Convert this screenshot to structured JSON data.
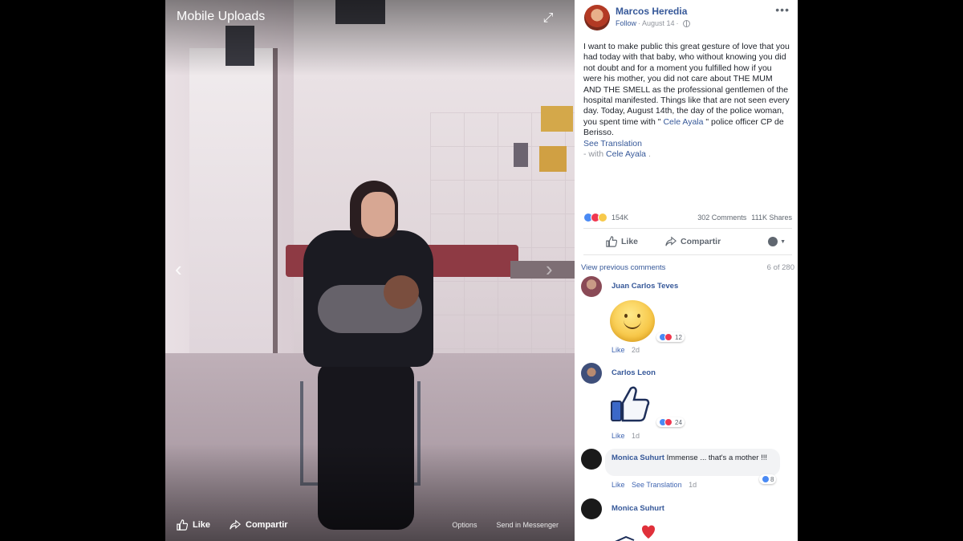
{
  "photo": {
    "album_title": "Mobile Uploads",
    "actions": {
      "like": "Like",
      "share": "Compartir",
      "options": "Options",
      "send": "Send in Messenger"
    }
  },
  "post": {
    "author": "Marcos Heredia",
    "follow": "Follow",
    "date": "August 14",
    "text_1": "I want to make public this great gesture of love that you had today with that baby, who without knowing you did not doubt and for a moment you fulfilled how if you were his mother, you did not care about THE MUM AND THE SMELL as the professional gentlemen of the hospital manifested. Things like that are not seen every day. Today, August 14th, the day of the police woman, you spent time with \"",
    "tag_1": "Cele Ayala",
    "text_2": "\" police officer CP de Berisso.",
    "see_translation": "See Translation",
    "with_prefix": "- with",
    "with_name": "Cele Ayala",
    "with_suffix": "."
  },
  "stats": {
    "reactions": "154K",
    "comments": "302 Comments",
    "shares": "111K Shares"
  },
  "post_actions": {
    "like": "Like",
    "share": "Compartir"
  },
  "comments_header": {
    "view_previous": "View previous comments",
    "pagination": "6 of 280"
  },
  "comments": [
    {
      "name": "Juan Carlos Teves",
      "like": "Like",
      "ago": "2d",
      "reactions": "12"
    },
    {
      "name": "Carlos Leon",
      "like": "Like",
      "ago": "1d",
      "reactions": "24"
    },
    {
      "name": "Monica Suhurt",
      "text": "Immense ... that's a mother !!!",
      "like": "Like",
      "translation": "See Translation",
      "ago": "1d",
      "reactions": "8"
    },
    {
      "name": "Monica Suhurt"
    }
  ],
  "colors": {
    "link": "#365899",
    "meta": "#90949c",
    "like_blue": "#4a8af4",
    "love_red": "#f0374f"
  }
}
